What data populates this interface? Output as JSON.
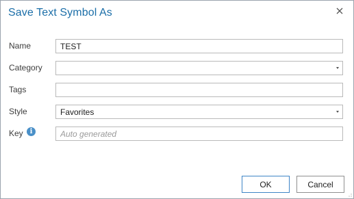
{
  "dialog": {
    "title": "Save Text Symbol As",
    "close_icon": "close-icon"
  },
  "form": {
    "name": {
      "label": "Name",
      "value": "TEST"
    },
    "category": {
      "label": "Category",
      "value": "",
      "icon": "chevron-down-icon"
    },
    "tags": {
      "label": "Tags",
      "value": ""
    },
    "style": {
      "label": "Style",
      "value": "Favorites",
      "icon": "chevron-down-icon"
    },
    "key": {
      "label": "Key",
      "value": "",
      "placeholder": "Auto generated",
      "info_icon": "info-icon",
      "info_glyph": "i"
    }
  },
  "buttons": {
    "ok_label": "OK",
    "cancel_label": "Cancel"
  },
  "colors": {
    "title": "#1b6ea8",
    "accent_border": "#3d84c6",
    "info_icon": "#4a90c8"
  }
}
